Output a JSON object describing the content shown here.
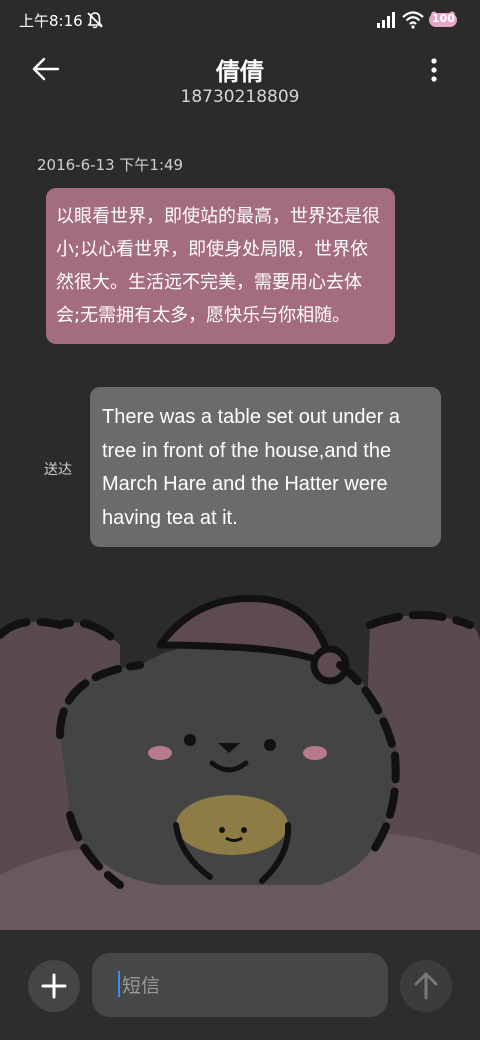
{
  "status_bar": {
    "time": "上午8:16",
    "battery_level": "100"
  },
  "header": {
    "contact_name": "倩倩",
    "phone_number": "18730218809"
  },
  "conversation": {
    "timestamp": "2016-6-13 下午1:49",
    "incoming_message": "以眼看世界，即使站的最高，世界还是很小;以心看世界，即使身处局限，世界依然很大。生活远不完美，需要用心去体会;无需拥有太多，愿快乐与你相随。",
    "outgoing_message": "There was a table set out under a tree in front of the house,and the March Hare and the Hatter were having tea at it.",
    "outgoing_status": "送达"
  },
  "composer": {
    "placeholder": "短信",
    "value": ""
  },
  "colors": {
    "background": "#2b2b2b",
    "incoming_bubble": "#a46d7f",
    "outgoing_bubble": "#6b6b6b",
    "caret": "#3a8ef0"
  },
  "icons": {
    "back": "arrow-left-icon",
    "more": "vertical-ellipsis-icon",
    "add": "plus-icon",
    "send": "arrow-up-icon",
    "mute": "bell-muted-icon",
    "signal": "cellular-signal-icon",
    "wifi": "wifi-icon",
    "battery": "battery-icon"
  }
}
